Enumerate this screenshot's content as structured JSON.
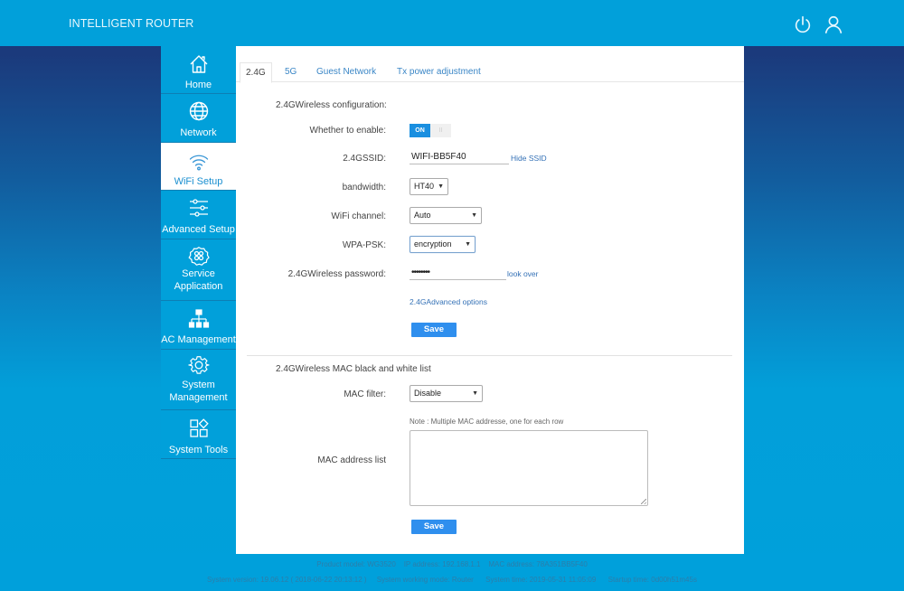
{
  "header": {
    "title": "INTELLIGENT ROUTER",
    "power_icon": "power-icon",
    "user_icon": "user-icon"
  },
  "sidebar": {
    "items": [
      {
        "label": "Home",
        "icon": "home-icon",
        "active": false
      },
      {
        "label": "Network",
        "icon": "globe-icon",
        "active": false
      },
      {
        "label": "WiFi Setup",
        "icon": "wifi-icon",
        "active": true
      },
      {
        "label": "Advanced Setup",
        "icon": "sliders-icon",
        "active": false
      },
      {
        "label": "Service Application",
        "icon": "service-icon",
        "active": false
      },
      {
        "label": "AC Management",
        "icon": "network-tree-icon",
        "active": false
      },
      {
        "label": "System Management",
        "icon": "gear-icon",
        "active": false
      },
      {
        "label": "System Tools",
        "icon": "tools-grid-icon",
        "active": false
      }
    ]
  },
  "tabs": [
    {
      "label": "2.4G",
      "active": true
    },
    {
      "label": "5G",
      "active": false
    },
    {
      "label": "Guest Network",
      "active": false
    },
    {
      "label": "Tx power adjustment",
      "active": false
    }
  ],
  "wireless_config": {
    "section_title": "2.4GWireless configuration:",
    "enable_label": "Whether to enable:",
    "enable_on_text": "ON",
    "enable_off_text": "II",
    "enabled": true,
    "ssid_label": "2.4GSSID:",
    "ssid_value": "WIFI-BB5F40",
    "hide_ssid_link": "Hide SSID",
    "bandwidth_label": "bandwidth:",
    "bandwidth_value": "HT40",
    "channel_label": "WiFi channel:",
    "channel_value": "Auto",
    "wpa_label": "WPA-PSK:",
    "wpa_value": "encryption",
    "password_label": "2.4GWireless password:",
    "password_value": "••••••••",
    "look_over_link": "look over",
    "advanced_link": "2.4GAdvanced options",
    "save_label": "Save"
  },
  "mac_filter": {
    "section_title": "2.4GWireless MAC black and white list",
    "filter_label": "MAC filter:",
    "filter_value": "Disable",
    "note": "Note : Multiple MAC addresse, one for each row",
    "list_label": "MAC address list",
    "list_value": "",
    "save_label": "Save"
  },
  "footer": {
    "line1": "Product model: WG3520    IP address: 192.168.1.1    MAC address: 78A351BB5F40",
    "line2": "System version: 19.06.12 ( 2018-06-22 20:13:12 )     System working mode: Router      System time: 2019-05-31 11:05:09      Startup time: 0d00h51m45s"
  }
}
